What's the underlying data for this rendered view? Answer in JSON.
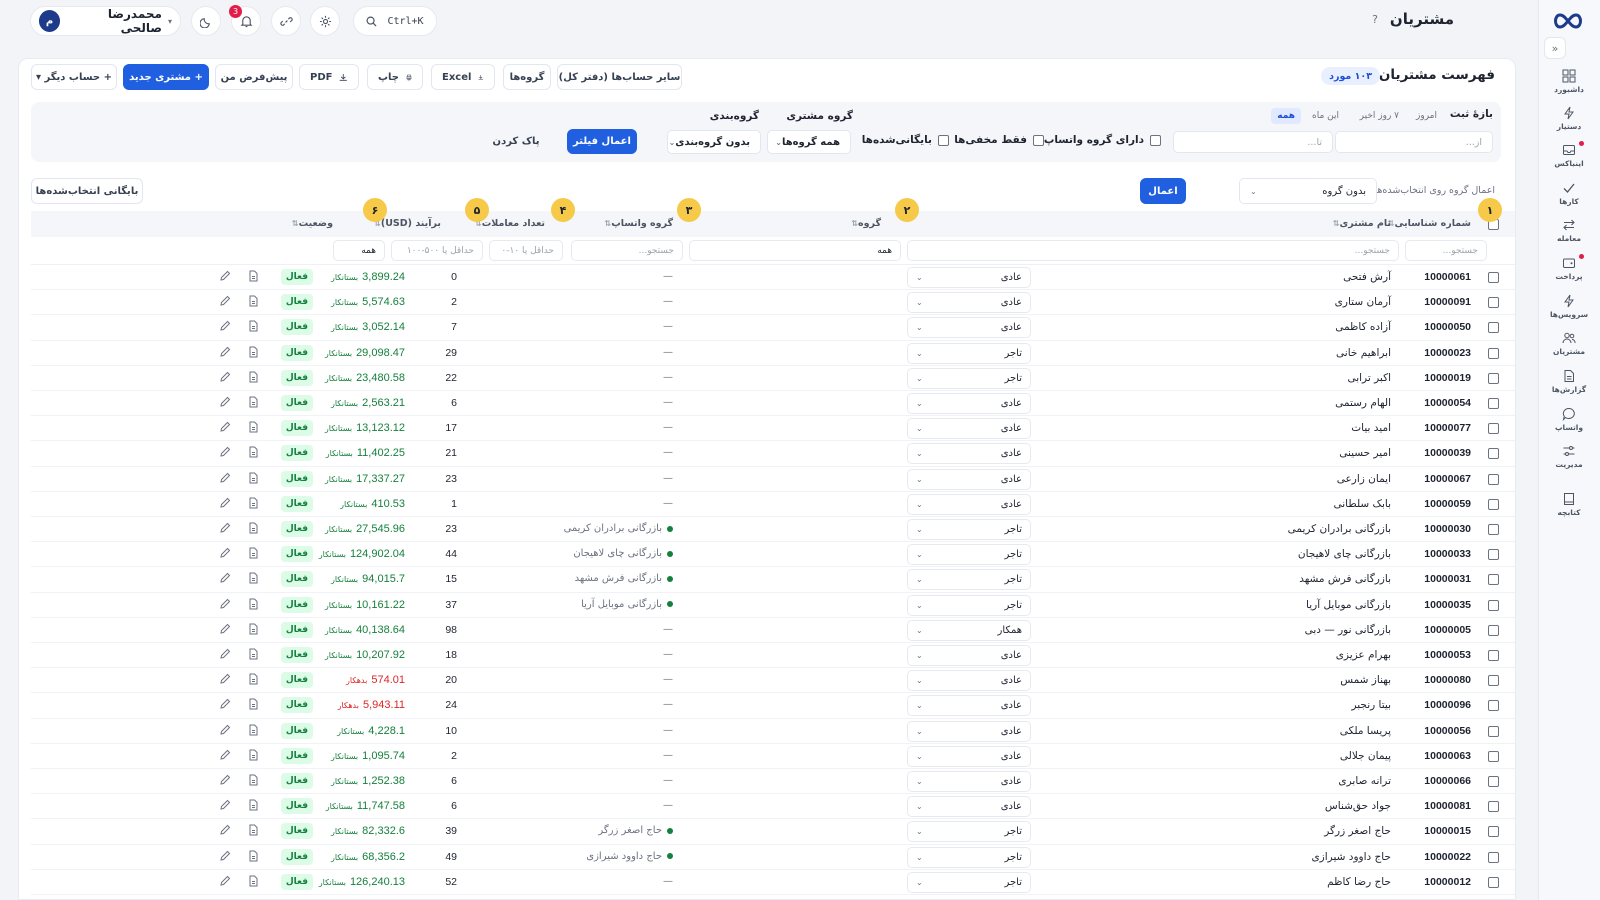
{
  "app": {
    "page_title": "مشتریان",
    "help_icon": "?"
  },
  "header": {
    "user_name": "محمدرضا صالحی",
    "user_initial": "م",
    "notifications_count": "3",
    "search_shortcut": "Ctrl+K"
  },
  "sidebar": {
    "items": [
      {
        "label": "داشبورد",
        "icon": "dashboard-icon"
      },
      {
        "label": "دستیار",
        "icon": "bolt-icon"
      },
      {
        "label": "اینباکس",
        "icon": "inbox-icon"
      },
      {
        "label": "کارها",
        "icon": "check-icon"
      },
      {
        "label": "معامله",
        "icon": "exchange-icon"
      },
      {
        "label": "پرداخت",
        "icon": "wallet-icon"
      },
      {
        "label": "سرویس‌ها",
        "icon": "lightning-icon"
      },
      {
        "label": "مشتریان",
        "icon": "users-icon"
      },
      {
        "label": "گزارش‌ها",
        "icon": "report-icon"
      },
      {
        "label": "واتساپ",
        "icon": "chat-icon"
      },
      {
        "label": "مدیریت",
        "icon": "sliders-icon"
      },
      {
        "label": "کتابچه",
        "icon": "book-icon"
      }
    ]
  },
  "list": {
    "title": "فهرست مشتریان",
    "count_badge": "۱۰۳ مورد",
    "toolbar": {
      "other_accounts": "سایر حساب‌ها (دفتر کل)",
      "groups": "گروه‌ها",
      "excel": "Excel",
      "print": "چاپ",
      "pdf": "PDF",
      "my_default": "پیش‌فرض من",
      "new_customer": "+ مشتری جدید",
      "other_account": "+ حساب دیگر ▾"
    }
  },
  "filters": {
    "date_range_label": "بازهٔ ثبت",
    "range_chips": [
      "امروز",
      "۷ روز اخیر",
      "این ماه",
      "همه"
    ],
    "from_placeholder": "از...",
    "to_placeholder": "تا...",
    "customer_group_label": "گروه مشتری",
    "grouping_label": "گروه‌بندی",
    "has_whatsapp": "دارای گروه واتساپ",
    "only_hidden": "فقط مخفی‌ها",
    "archived": "بایگانی‌شده‌ها",
    "all_groups": "همه گروه‌ها",
    "no_grouping": "بدون گروه‌بندی",
    "apply_filter": "اعمال فیلتر",
    "clear": "پاک کردن"
  },
  "bulk": {
    "label": "اعمال گروه روی انتخاب‌شده‌ها:",
    "select_value": "بدون گروه",
    "apply": "اعمال",
    "archive_selected": "بایگانی انتخاب‌شده‌ها"
  },
  "table": {
    "headers": {
      "id": "شماره شناسایی",
      "name": "نام مشتری",
      "group": "گروه",
      "whatsapp": "گروه واتساپ",
      "transactions": "تعداد معاملات",
      "balance": "برآیند (USD)",
      "status": "وضعیت"
    },
    "filter_placeholders": {
      "id": "جستجو...",
      "name": "جستجو...",
      "group": "همه",
      "whatsapp": "جستجو...",
      "transactions": "حداقل یا ۱۰-۰",
      "balance": "حداقل یا ۵۰۰-۱۰۰",
      "status": "همه"
    },
    "markers": [
      "۱",
      "۲",
      "۳",
      "۴",
      "۵",
      "۶"
    ],
    "rows": [
      {
        "id": "10000061",
        "name": "آرش فتحی",
        "group": "عادی",
        "whatsapp": "—",
        "wa_dot": false,
        "transactions": "0",
        "balance": "3,899.24",
        "balance_type": "بستانکار",
        "credit": true,
        "status": "فعال"
      },
      {
        "id": "10000091",
        "name": "آرمان ستاری",
        "group": "عادی",
        "whatsapp": "—",
        "wa_dot": false,
        "transactions": "2",
        "balance": "5,574.63",
        "balance_type": "بستانکار",
        "credit": true,
        "status": "فعال"
      },
      {
        "id": "10000050",
        "name": "آزاده کاظمی",
        "group": "عادی",
        "whatsapp": "—",
        "wa_dot": false,
        "transactions": "7",
        "balance": "3,052.14",
        "balance_type": "بستانکار",
        "credit": true,
        "status": "فعال"
      },
      {
        "id": "10000023",
        "name": "ابراهیم خانی",
        "group": "تاجر",
        "whatsapp": "—",
        "wa_dot": false,
        "transactions": "29",
        "balance": "29,098.47",
        "balance_type": "بستانکار",
        "credit": true,
        "status": "فعال"
      },
      {
        "id": "10000019",
        "name": "اکبر ترابی",
        "group": "تاجر",
        "whatsapp": "—",
        "wa_dot": false,
        "transactions": "22",
        "balance": "23,480.58",
        "balance_type": "بستانکار",
        "credit": true,
        "status": "فعال"
      },
      {
        "id": "10000054",
        "name": "الهام رستمی",
        "group": "عادی",
        "whatsapp": "—",
        "wa_dot": false,
        "transactions": "6",
        "balance": "2,563.21",
        "balance_type": "بستانکار",
        "credit": true,
        "status": "فعال"
      },
      {
        "id": "10000077",
        "name": "امید بیات",
        "group": "عادی",
        "whatsapp": "—",
        "wa_dot": false,
        "transactions": "17",
        "balance": "13,123.12",
        "balance_type": "بستانکار",
        "credit": true,
        "status": "فعال"
      },
      {
        "id": "10000039",
        "name": "امیر حسینی",
        "group": "عادی",
        "whatsapp": "—",
        "wa_dot": false,
        "transactions": "21",
        "balance": "11,402.25",
        "balance_type": "بستانکار",
        "credit": true,
        "status": "فعال"
      },
      {
        "id": "10000067",
        "name": "ایمان زارعی",
        "group": "عادی",
        "whatsapp": "—",
        "wa_dot": false,
        "transactions": "23",
        "balance": "17,337.27",
        "balance_type": "بستانکار",
        "credit": true,
        "status": "فعال"
      },
      {
        "id": "10000059",
        "name": "بابک سلطانی",
        "group": "عادی",
        "whatsapp": "—",
        "wa_dot": false,
        "transactions": "1",
        "balance": "410.53",
        "balance_type": "بستانکار",
        "credit": true,
        "status": "فعال"
      },
      {
        "id": "10000030",
        "name": "بازرگانی برادران کریمی",
        "group": "تاجر",
        "whatsapp": "بازرگانی برادران کریمی",
        "wa_dot": true,
        "transactions": "23",
        "balance": "27,545.96",
        "balance_type": "بستانکار",
        "credit": true,
        "status": "فعال"
      },
      {
        "id": "10000033",
        "name": "بازرگانی چای لاهیجان",
        "group": "تاجر",
        "whatsapp": "بازرگانی چای لاهیجان",
        "wa_dot": true,
        "transactions": "44",
        "balance": "124,902.04",
        "balance_type": "بستانکار",
        "credit": true,
        "status": "فعال"
      },
      {
        "id": "10000031",
        "name": "بازرگانی فرش مشهد",
        "group": "تاجر",
        "whatsapp": "بازرگانی فرش مشهد",
        "wa_dot": true,
        "transactions": "15",
        "balance": "94,015.7",
        "balance_type": "بستانکار",
        "credit": true,
        "status": "فعال"
      },
      {
        "id": "10000035",
        "name": "بازرگانی موبایل آریا",
        "group": "تاجر",
        "whatsapp": "بازرگانی موبایل آریا",
        "wa_dot": true,
        "transactions": "37",
        "balance": "10,161.22",
        "balance_type": "بستانکار",
        "credit": true,
        "status": "فعال"
      },
      {
        "id": "10000005",
        "name": "بازرگانی نور — دبی",
        "group": "همکار",
        "whatsapp": "—",
        "wa_dot": false,
        "transactions": "98",
        "balance": "40,138.64",
        "balance_type": "بستانکار",
        "credit": true,
        "status": "فعال"
      },
      {
        "id": "10000053",
        "name": "بهرام عزیزی",
        "group": "عادی",
        "whatsapp": "—",
        "wa_dot": false,
        "transactions": "18",
        "balance": "10,207.92",
        "balance_type": "بستانکار",
        "credit": true,
        "status": "فعال"
      },
      {
        "id": "10000080",
        "name": "بهناز شمس",
        "group": "عادی",
        "whatsapp": "—",
        "wa_dot": false,
        "transactions": "20",
        "balance": "574.01",
        "balance_type": "بدهکار",
        "credit": false,
        "status": "فعال"
      },
      {
        "id": "10000096",
        "name": "بیتا رنجبر",
        "group": "عادی",
        "whatsapp": "—",
        "wa_dot": false,
        "transactions": "24",
        "balance": "5,943.11",
        "balance_type": "بدهکار",
        "credit": false,
        "status": "فعال"
      },
      {
        "id": "10000056",
        "name": "پریسا ملکی",
        "group": "عادی",
        "whatsapp": "—",
        "wa_dot": false,
        "transactions": "10",
        "balance": "4,228.1",
        "balance_type": "بستانکار",
        "credit": true,
        "status": "فعال"
      },
      {
        "id": "10000063",
        "name": "پیمان جلالی",
        "group": "عادی",
        "whatsapp": "—",
        "wa_dot": false,
        "transactions": "2",
        "balance": "1,095.74",
        "balance_type": "بستانکار",
        "credit": true,
        "status": "فعال"
      },
      {
        "id": "10000066",
        "name": "ترانه صابری",
        "group": "عادی",
        "whatsapp": "—",
        "wa_dot": false,
        "transactions": "6",
        "balance": "1,252.38",
        "balance_type": "بستانکار",
        "credit": true,
        "status": "فعال"
      },
      {
        "id": "10000081",
        "name": "جواد حق‌شناس",
        "group": "عادی",
        "whatsapp": "—",
        "wa_dot": false,
        "transactions": "6",
        "balance": "11,747.58",
        "balance_type": "بستانکار",
        "credit": true,
        "status": "فعال"
      },
      {
        "id": "10000015",
        "name": "حاج اصغر زرگر",
        "group": "تاجر",
        "whatsapp": "حاج اصغر زرگر",
        "wa_dot": true,
        "transactions": "39",
        "balance": "82,332.6",
        "balance_type": "بستانکار",
        "credit": true,
        "status": "فعال"
      },
      {
        "id": "10000022",
        "name": "حاج داوود شیرازی",
        "group": "تاجر",
        "whatsapp": "حاج داوود شیرازی",
        "wa_dot": true,
        "transactions": "49",
        "balance": "68,356.2",
        "balance_type": "بستانکار",
        "credit": true,
        "status": "فعال"
      },
      {
        "id": "10000012",
        "name": "حاج رضا کاظم",
        "group": "تاجر",
        "whatsapp": "—",
        "wa_dot": false,
        "transactions": "52",
        "balance": "126,240.13",
        "balance_type": "بستانکار",
        "credit": true,
        "status": "فعال"
      }
    ]
  },
  "colors": {
    "primary": "#1f5fe0",
    "credit": "#15803d",
    "debit": "#dc2626",
    "marker": "#f7c948",
    "status_bg": "#dcfce7"
  }
}
